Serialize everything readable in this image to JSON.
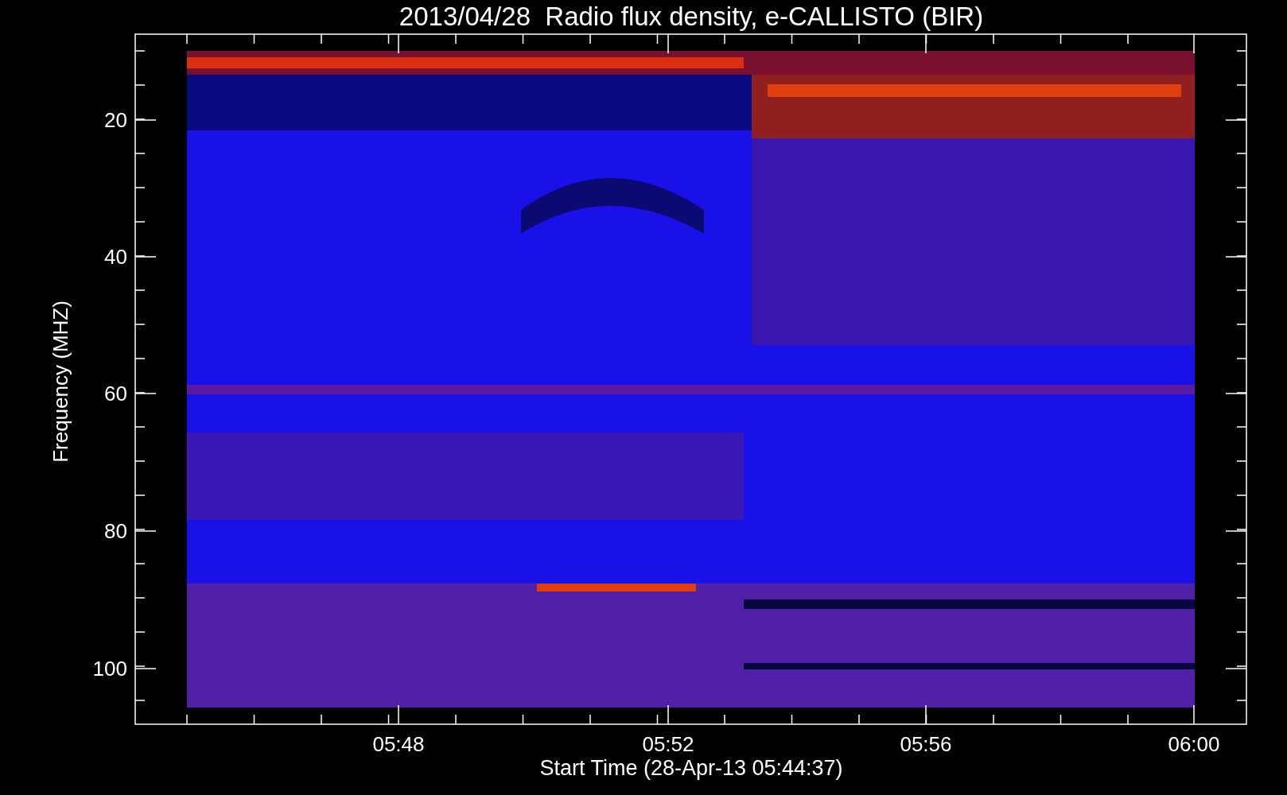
{
  "title": "2013/04/28  Radio flux density, e-CALLISTO (BIR)",
  "y_axis": {
    "label": "Frequency (MHZ)",
    "ticks": [
      "20",
      "40",
      "60",
      "80",
      "100"
    ]
  },
  "x_axis": {
    "label": "Start Time (28-Apr-13 05:44:37)",
    "ticks": [
      "05:48",
      "05:52",
      "05:56",
      "06:00"
    ]
  }
}
